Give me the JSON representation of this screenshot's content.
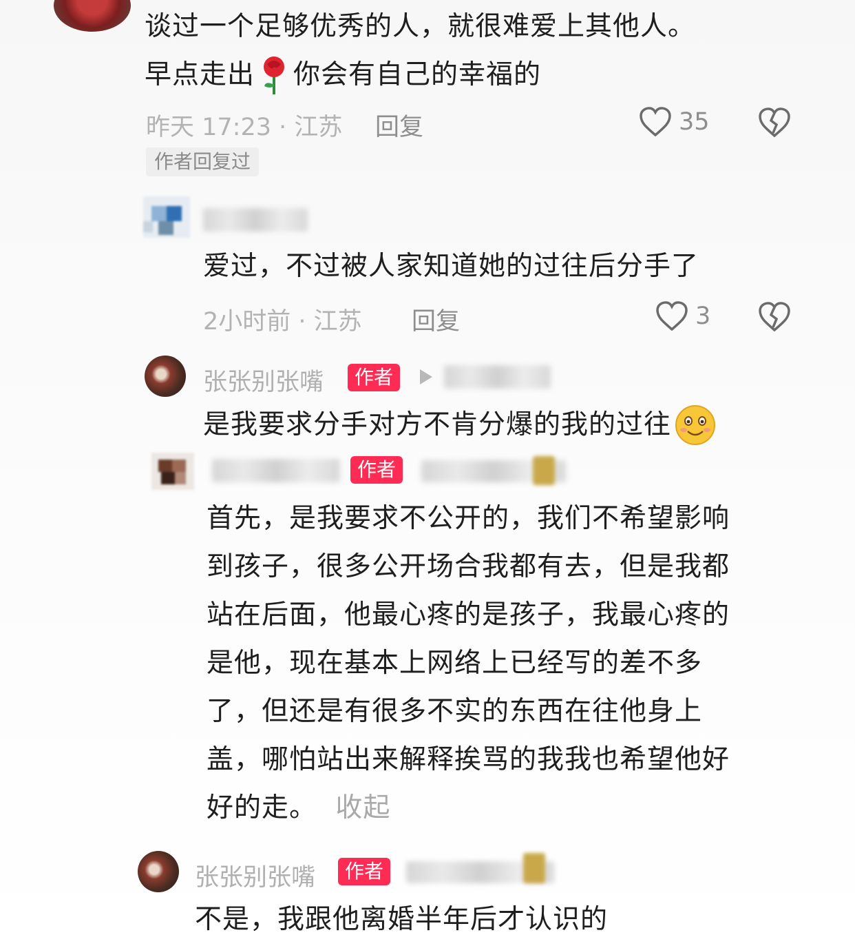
{
  "comment_top": {
    "line1": "谈过一个足够优秀的人，就很难爱上其他人。",
    "line2_start": "早点走出",
    "line2_emoji": "rose-emoji",
    "line2_end": "你会有自己的幸福的",
    "meta": "昨天 17:23 · 江苏",
    "reply_label": "回复",
    "like_count": "35",
    "badge": "作者回复过"
  },
  "reply1": {
    "text": "爱过，不过被人家知道她的过往后分手了",
    "meta": "2小时前 · 江苏",
    "reply_label": "回复",
    "like_count": "3"
  },
  "reply2": {
    "name": "张张别张嘴",
    "badge": "作者",
    "text": "是我要求分手对方不肯分爆的我的过往",
    "emoji": "smile-emoji"
  },
  "reply3": {
    "badge": "作者",
    "lines": [
      "首先，是我要求不公开的，我们不希望影响",
      "到孩子，很多公开场合我都有去，但是我都",
      "站在后面，他最心疼的是孩子，我最心疼的",
      "是他，现在基本上网络上已经写的差不多",
      "了，但还是有很多不实的东西在往他身上",
      "盖，哪怕站出来解释挨骂的我我也希望他好",
      "好的走。"
    ],
    "collapse_label": "收起"
  },
  "reply4": {
    "name": "张张别张嘴",
    "badge": "作者",
    "text": "不是，我跟他离婚半年后才认识的"
  },
  "colors": {
    "accent": "#fe2c55",
    "meta_text": "#b3b3b3",
    "body_text": "#1e1e1e"
  }
}
